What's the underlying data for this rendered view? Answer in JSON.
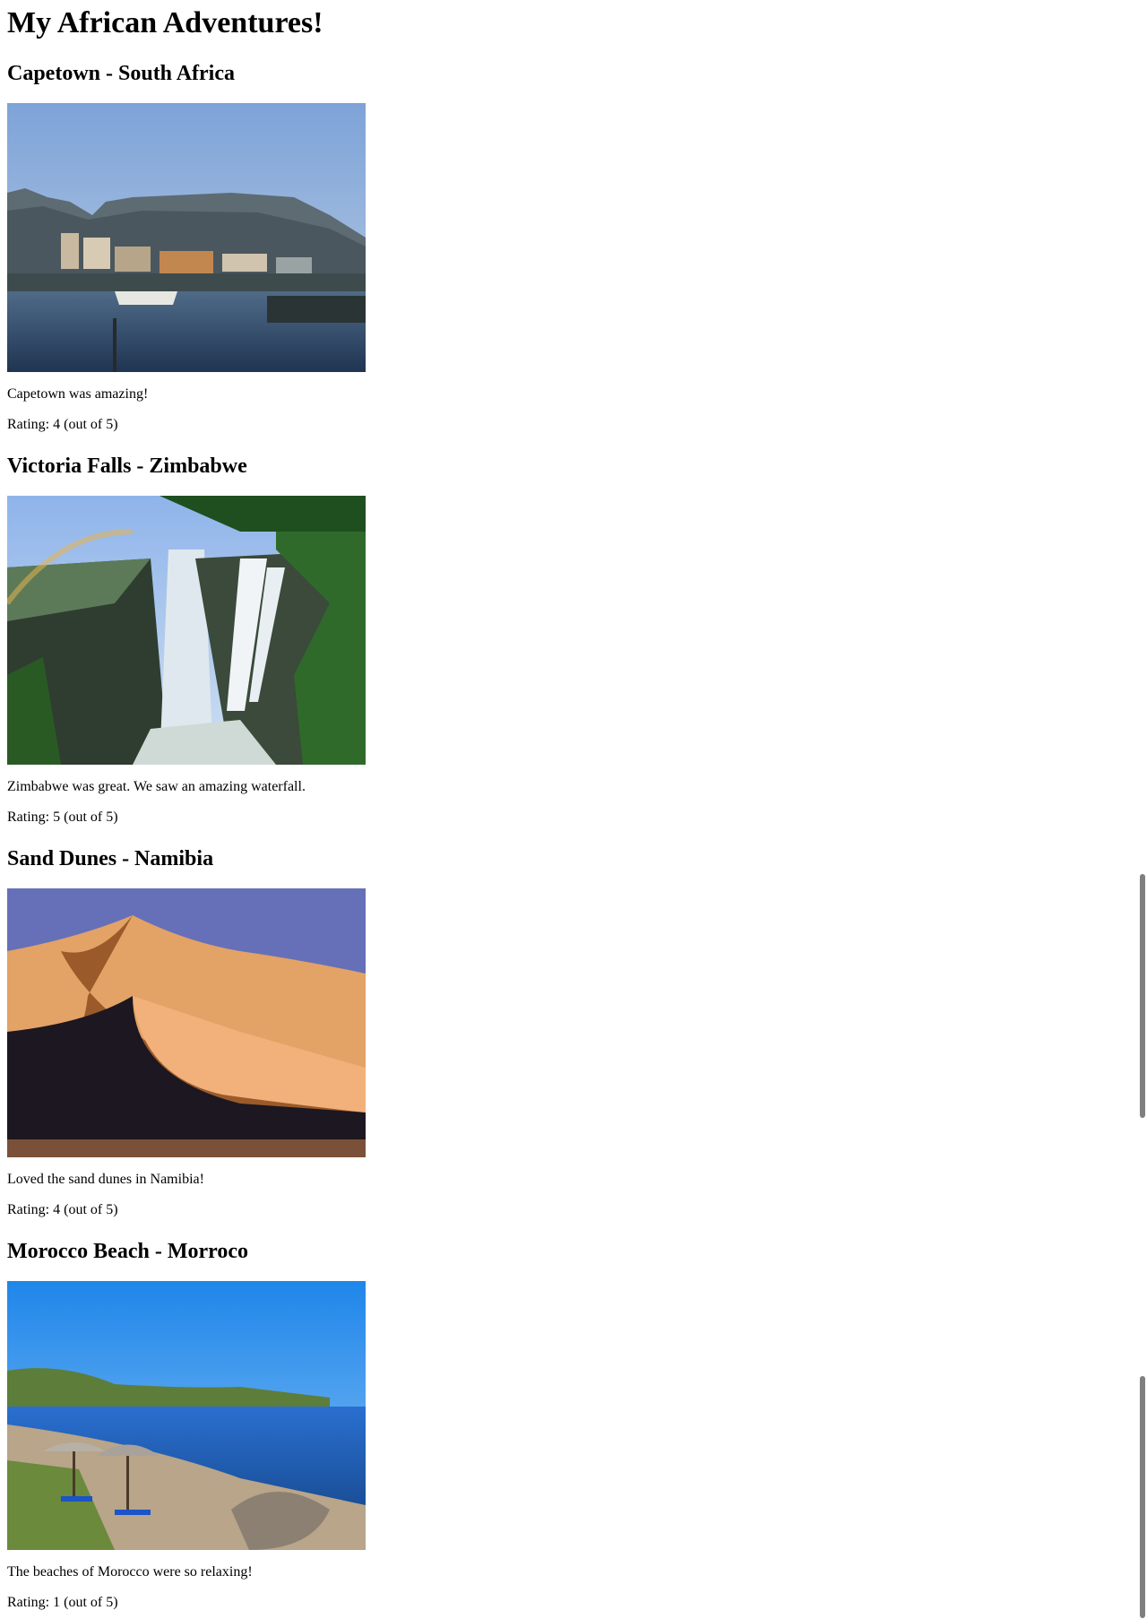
{
  "page": {
    "title": "My African Adventures!"
  },
  "entries": [
    {
      "heading": "Capetown - South Africa",
      "caption": "Capetown was amazing!",
      "rating": "Rating: 4 (out of 5)",
      "image_subject": "table-mountain-harbor"
    },
    {
      "heading": "Victoria Falls - Zimbabwe",
      "caption": "Zimbabwe was great. We saw an amazing waterfall.",
      "rating": "Rating: 5 (out of 5)",
      "image_subject": "waterfall-gorge"
    },
    {
      "heading": "Sand Dunes - Namibia",
      "caption": "Loved the sand dunes in Namibia!",
      "rating": "Rating: 4 (out of 5)",
      "image_subject": "orange-sand-dunes"
    },
    {
      "heading": "Morocco Beach - Morroco",
      "caption": "The beaches of Morocco were so relaxing!",
      "rating": "Rating: 1 (out of 5)",
      "image_subject": "beach-with-umbrellas"
    }
  ],
  "colors": {
    "text": "#000000",
    "background": "#ffffff",
    "scrollbar": "#7f7f7f"
  }
}
